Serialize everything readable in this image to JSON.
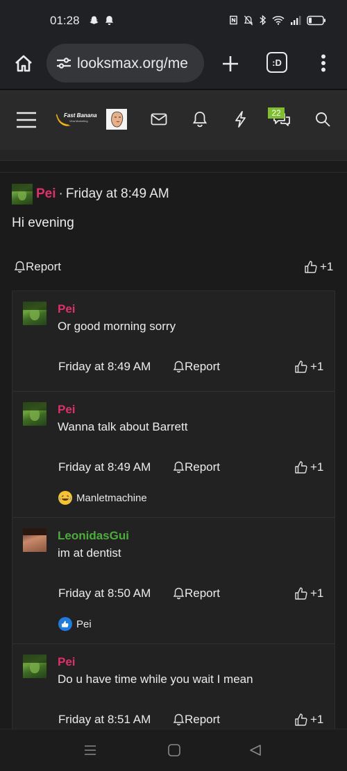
{
  "status_bar": {
    "time": "01:28",
    "icons_left": [
      "snapchat-icon",
      "bell-icon"
    ],
    "icons_right": [
      "nfc-icon",
      "mute-icon",
      "bluetooth-icon",
      "wifi-icon",
      "signal-icon",
      "battery-icon"
    ]
  },
  "browser": {
    "url": "looksmax.org/me",
    "tabs_label": ":D"
  },
  "site_nav": {
    "logo_text": "Fast Banana",
    "logo_subtext": "Vina Marketing",
    "notifications_badge": "22"
  },
  "post": {
    "author": "Pei",
    "separator": "·",
    "time": "Friday at 8:49 AM",
    "body": "Hi evening",
    "report_label": "Report",
    "like_label": "+1"
  },
  "comments": [
    {
      "author": "Pei",
      "text": "Or good morning sorry",
      "time": "Friday at 8:49 AM",
      "report_label": "Report",
      "like_label": "+1"
    },
    {
      "author": "Pei",
      "text": "Wanna talk about Barrett",
      "time": "Friday at 8:49 AM",
      "report_label": "Report",
      "like_label": "+1",
      "reaction": {
        "icon": "crying-laughing-emoji-icon",
        "user": "Manletmachine"
      }
    },
    {
      "author": "LeonidasGui",
      "text": "im at dentist",
      "time": "Friday at 8:50 AM",
      "report_label": "Report",
      "like_label": "+1",
      "reaction": {
        "icon": "thumbs-up-reaction-icon",
        "user": "Pei"
      }
    },
    {
      "author": "Pei",
      "text": "Do u have time while you wait I mean",
      "time": "Friday at 8:51 AM",
      "report_label": "Report",
      "like_label": "+1"
    }
  ],
  "colors": {
    "background": "#1b1b1b",
    "username_pink": "#e0306a",
    "username_green": "#4cae3a",
    "badge_green": "#7fbf2e"
  }
}
